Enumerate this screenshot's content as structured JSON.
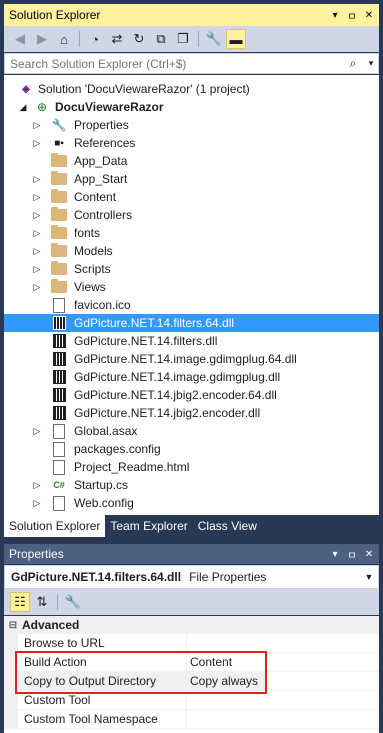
{
  "solution_explorer": {
    "title": "Solution Explorer",
    "search_placeholder": "Search Solution Explorer (Ctrl+$)"
  },
  "tree": {
    "solution": "Solution 'DocuViewareRazor' (1 project)",
    "project": "DocuViewareRazor",
    "items": [
      {
        "label": "Properties",
        "icon": "wrench-icon"
      },
      {
        "label": "References",
        "icon": "references-icon"
      },
      {
        "label": "App_Data",
        "icon": "folder-icon"
      },
      {
        "label": "App_Start",
        "icon": "folder-icon"
      },
      {
        "label": "Content",
        "icon": "folder-icon"
      },
      {
        "label": "Controllers",
        "icon": "folder-icon"
      },
      {
        "label": "fonts",
        "icon": "folder-icon"
      },
      {
        "label": "Models",
        "icon": "folder-icon"
      },
      {
        "label": "Scripts",
        "icon": "folder-icon"
      },
      {
        "label": "Views",
        "icon": "folder-icon"
      },
      {
        "label": "favicon.ico",
        "icon": "file-icon"
      },
      {
        "label": "GdPicture.NET.14.filters.64.dll",
        "icon": "dll-icon"
      },
      {
        "label": "GdPicture.NET.14.filters.dll",
        "icon": "dll-icon"
      },
      {
        "label": "GdPicture.NET.14.image.gdimgplug.64.dll",
        "icon": "dll-icon"
      },
      {
        "label": "GdPicture.NET.14.image.gdimgplug.dll",
        "icon": "dll-icon"
      },
      {
        "label": "GdPicture.NET.14.jbig2.encoder.64.dll",
        "icon": "dll-icon"
      },
      {
        "label": "GdPicture.NET.14.jbig2.encoder.dll",
        "icon": "dll-icon"
      },
      {
        "label": "Global.asax",
        "icon": "asax-icon"
      },
      {
        "label": "packages.config",
        "icon": "config-icon"
      },
      {
        "label": "Project_Readme.html",
        "icon": "html-file-icon"
      },
      {
        "label": "Startup.cs",
        "icon": "csharp-icon",
        "glyph": "C#"
      },
      {
        "label": "Web.config",
        "icon": "web-config-icon"
      }
    ]
  },
  "bottom_tabs": [
    "Solution Explorer",
    "Team Explorer",
    "Class View"
  ],
  "properties": {
    "title": "Properties",
    "object_name": "GdPicture.NET.14.filters.64.dll",
    "object_type": "File Properties",
    "category": "Advanced",
    "rows": [
      {
        "name": "Browse to URL",
        "value": ""
      },
      {
        "name": "Build Action",
        "value": "Content"
      },
      {
        "name": "Copy to Output Directory",
        "value": "Copy always"
      },
      {
        "name": "Custom Tool",
        "value": ""
      },
      {
        "name": "Custom Tool Namespace",
        "value": ""
      }
    ]
  },
  "colors": {
    "selection": "#3399ff",
    "active_header": "#fff29d",
    "highlight_box": "#e0201a"
  }
}
